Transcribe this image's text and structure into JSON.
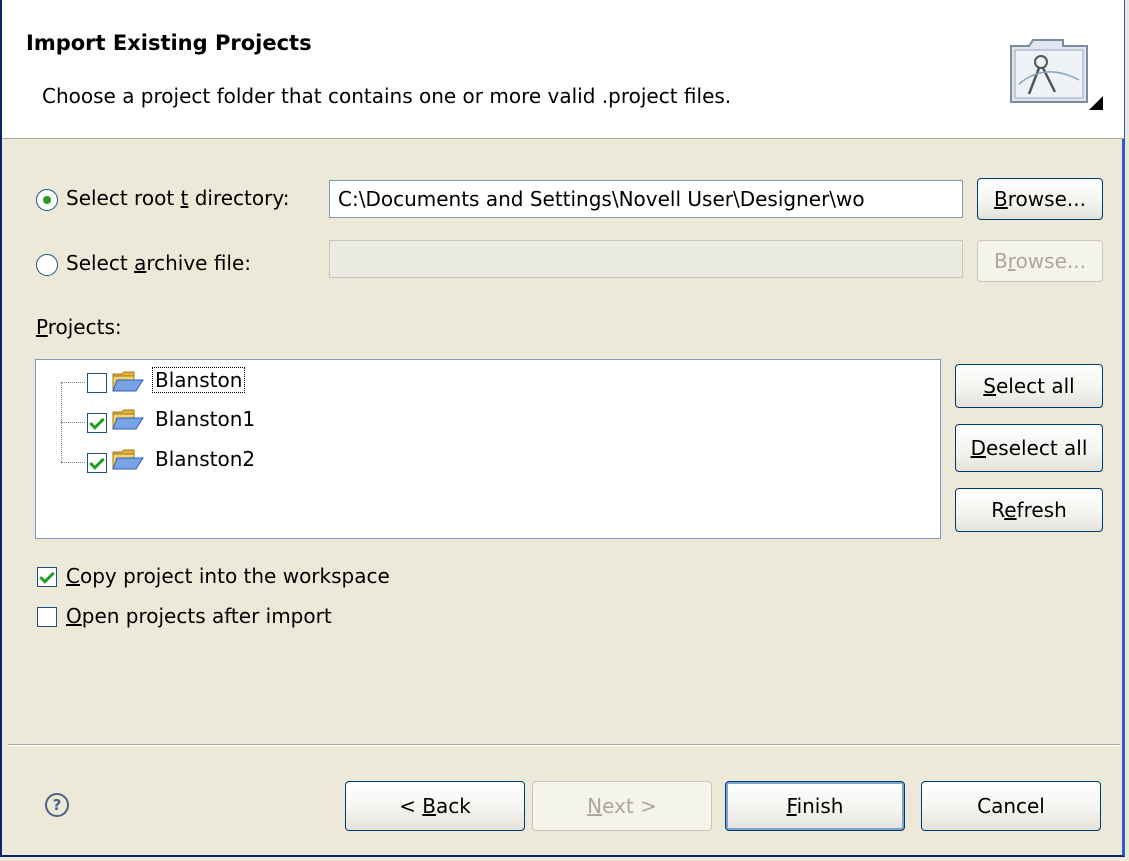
{
  "header": {
    "title": "Import Existing Projects",
    "message": "Choose a project folder that contains one or more valid .project files."
  },
  "source": {
    "root_radio_pre": "Select root ",
    "root_radio_ul": "t",
    "root_radio_post": " directory:",
    "root_path": "C:\\Documents and Settings\\Novell User\\Designer\\wo",
    "archive_radio_pre": "Select ",
    "archive_radio_ul": "a",
    "archive_radio_post": "rchive file:",
    "archive_path": "",
    "browse_ul": "B",
    "browse_rest": "rowse...",
    "browse2_pre": "B",
    "browse2_ul": "r",
    "browse2_post": "owse..."
  },
  "projects": {
    "label_ul": "P",
    "label_rest": "rojects:",
    "items": [
      {
        "name": "Blanston",
        "checked": false
      },
      {
        "name": "Blanston1",
        "checked": true
      },
      {
        "name": "Blanston2",
        "checked": true
      }
    ],
    "select_all_ul": "S",
    "select_all_rest": "elect all",
    "deselect_all_ul": "D",
    "deselect_all_rest": "eselect all",
    "refresh_pre": "R",
    "refresh_ul": "e",
    "refresh_post": "fresh"
  },
  "options": {
    "copy_ul": "C",
    "copy_rest": "opy project into the workspace",
    "copy_checked": true,
    "open_ul": "O",
    "open_rest": "pen projects after import",
    "open_checked": false
  },
  "footer": {
    "help_glyph": "?",
    "back_pre": "< ",
    "back_ul": "B",
    "back_post": "ack",
    "next_ul": "N",
    "next_post": "ext >",
    "finish_ul": "F",
    "finish_post": "inish",
    "cancel": "Cancel"
  },
  "colors": {
    "dialog_bg": "#ece9d8",
    "radio_dot": "#21a121",
    "check_mark": "#21a121",
    "folder": "#f5c94a"
  }
}
